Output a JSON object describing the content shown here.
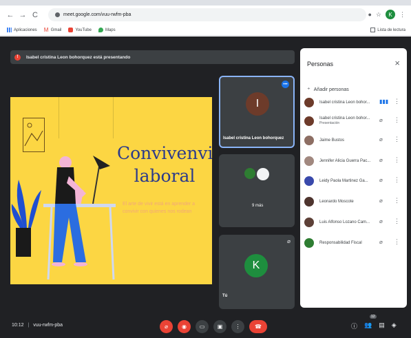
{
  "browser": {
    "url": "meet.google.com/vuu-rwfm-pba",
    "bookmarks": [
      "Aplicaciones",
      "Gmail",
      "YouTube",
      "Maps"
    ],
    "reading_list": "Lista de lectura",
    "profile_initial": "K"
  },
  "meet": {
    "presenting_text": "Isabel cristina Leon bohorquez está presentando",
    "slide": {
      "title": "Convivenvia laboral",
      "subtitle": "El arte de vivir está en aprender a convivir con quienes nos rodean"
    },
    "tiles": [
      {
        "name": "Isabel cristina Leon bohorquez",
        "initial": "I"
      },
      {
        "more": "9 más"
      },
      {
        "name": "Tú",
        "initial": "K"
      }
    ],
    "people_panel": {
      "title": "Personas",
      "add_people": "Añadir personas",
      "people": [
        {
          "name": "Isabel cristina Leon bohor...",
          "sub": ""
        },
        {
          "name": "Isabel cristina Leon bohor...",
          "sub": "Presentación"
        },
        {
          "name": "Jaime Bustos",
          "sub": ""
        },
        {
          "name": "Jennifer Alicia Guerra Pac...",
          "sub": ""
        },
        {
          "name": "Leidy Paola Martinez Ga...",
          "sub": ""
        },
        {
          "name": "Leonardo Moscote",
          "sub": ""
        },
        {
          "name": "Luis Alfonso Lozano Cam...",
          "sub": ""
        },
        {
          "name": "Responsabilidad Fiscal",
          "sub": ""
        }
      ]
    },
    "bottom": {
      "time": "10:12",
      "code": "vuu-rwfm-pba",
      "participants_count": "12"
    }
  }
}
